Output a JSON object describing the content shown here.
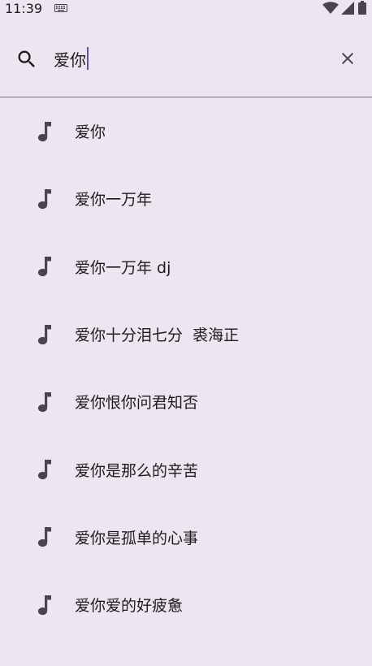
{
  "status_bar": {
    "time": "11:39",
    "icons": [
      "keyboard-icon",
      "wifi-icon",
      "signal-icon",
      "battery-icon"
    ]
  },
  "search": {
    "icon": "search-icon",
    "query": "爱你",
    "clear_icon": "close-icon"
  },
  "suggestions": [
    {
      "label": "爱你",
      "icon": "music-note-icon"
    },
    {
      "label": "爱你一万年",
      "icon": "music-note-icon"
    },
    {
      "label": "爱你一万年 dj",
      "icon": "music-note-icon"
    },
    {
      "label": "爱你十分泪七分  裘海正",
      "icon": "music-note-icon"
    },
    {
      "label": "爱你恨你问君知否",
      "icon": "music-note-icon"
    },
    {
      "label": "爱你是那么的辛苦",
      "icon": "music-note-icon"
    },
    {
      "label": "爱你是孤单的心事",
      "icon": "music-note-icon"
    },
    {
      "label": "爱你爱的好疲惫",
      "icon": "music-note-icon"
    }
  ],
  "colors": {
    "background": "#ECE6F0",
    "text": "#1D1B20",
    "icon": "#49454F",
    "divider": "#79747E",
    "caret": "#6750A4"
  }
}
